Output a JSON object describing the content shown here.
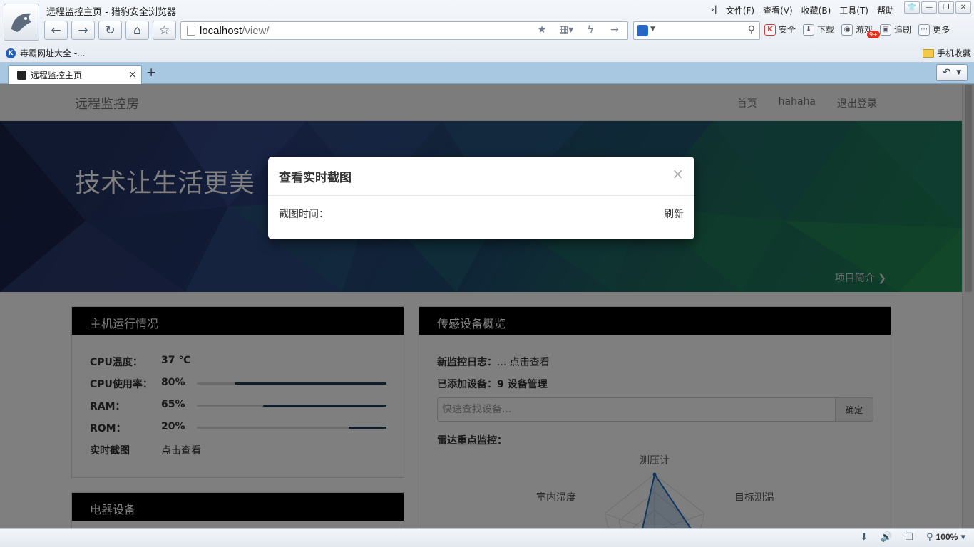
{
  "browser": {
    "window_title": "远程监控主页 - 猎豹安全浏览器",
    "menu": [
      "文件(F)",
      "查看(V)",
      "收藏(B)",
      "工具(T)",
      "帮助"
    ],
    "address": {
      "host": "localhost",
      "path": "/view/"
    },
    "toolbar": [
      {
        "label": "安全",
        "icon": "shield-k-icon"
      },
      {
        "label": "下载",
        "icon": "download-icon"
      },
      {
        "label": "游戏",
        "icon": "gamepad-icon",
        "badge": "9+"
      },
      {
        "label": "追剧",
        "icon": "tv-icon"
      },
      {
        "label": "更多",
        "icon": "more-icon"
      }
    ],
    "bookmark_left": "毒霸网址大全 -...",
    "bookmark_right": "手机收藏",
    "tab_title": "远程监控主页",
    "zoom": "100%"
  },
  "site": {
    "brand": "远程监控房",
    "nav": [
      "首页",
      "hahaha",
      "退出登录"
    ],
    "hero_title": "技术让生活更美",
    "hero_link": "项目简介"
  },
  "host_panel": {
    "title": "主机运行情况",
    "cpu_temp_label": "CPU温度：",
    "cpu_temp_value": "37 ℃",
    "cpu_usage_label": "CPU使用率：",
    "cpu_usage_value": "80%",
    "cpu_usage_fraction": 0.8,
    "ram_label": "RAM：",
    "ram_value": "65%",
    "ram_fraction": 0.65,
    "rom_label": "ROM：",
    "rom_value": "20%",
    "rom_fraction": 0.2,
    "screenshot_label": "实时截图",
    "screenshot_link": "点击查看"
  },
  "appliance_panel": {
    "title": "电器设备"
  },
  "sensor_panel": {
    "title": "传感设备概览",
    "log_label": "新监控日志：",
    "log_value": "... 点击查看",
    "added_label": "已添加设备：",
    "added_value": "9 设备管理",
    "search_placeholder": "快速查找设备...",
    "confirm_label": "确定",
    "radar_label": "雷达重点监控：",
    "radar_axes": [
      "测压计",
      "目标测温",
      "室内湿度"
    ]
  },
  "modal": {
    "title": "查看实时截图",
    "time_label": "截图时间：",
    "refresh_label": "刷新",
    "close_label": "×"
  }
}
